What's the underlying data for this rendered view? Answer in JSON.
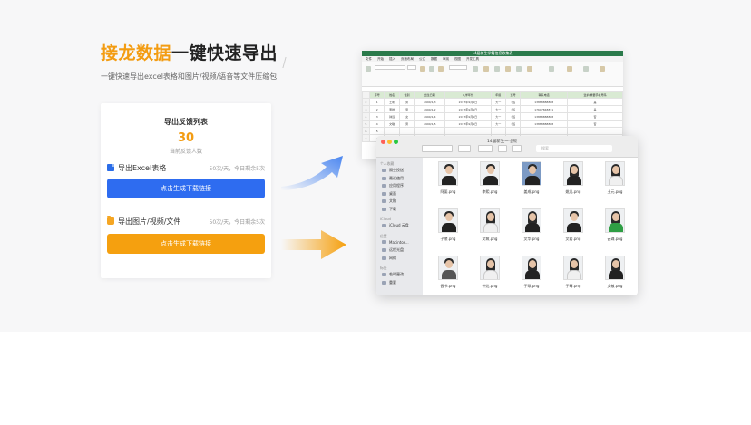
{
  "hero": {
    "title_highlight": "接龙数据",
    "title_rest": "一键快速导出",
    "subtitle": "一键快速导出excel表格和图片/视频/语音等文件压缩包"
  },
  "card": {
    "title": "导出反馈列表",
    "count": "30",
    "count_label": "当前反馈人数",
    "excel": {
      "label": "导出Excel表格",
      "quota": "50次/天，今日剩余5次",
      "button": "点击生成下载链接"
    },
    "media": {
      "label": "导出图片/视频/文件",
      "quota": "50次/天，今日剩余5次",
      "button": "点击生成下载链接"
    }
  },
  "spreadsheet": {
    "window_title": "14届新生学籍信息收集表",
    "menu": [
      "文件",
      "开始",
      "插入",
      "页面布局",
      "公式",
      "数据",
      "审阅",
      "视图",
      "开发工具"
    ],
    "headers": [
      "序号",
      "姓名",
      "性别",
      "出生日期",
      "入学年份",
      "年级",
      "班号",
      "联系电话",
      "监护/重要手机号码"
    ],
    "rows": [
      [
        "1",
        "王昕",
        "男",
        "1990/1/3",
        "2017年9月1日",
        "大一",
        "1班",
        "13888888888",
        "是"
      ],
      [
        "2",
        "李晗",
        "男",
        "1990/1/2",
        "2017年9月1日",
        "大一",
        "1班",
        "17607848871",
        "是"
      ],
      [
        "3",
        "钟远",
        "女",
        "1990/1/4",
        "2017年9月1日",
        "大一",
        "1班",
        "13888888888",
        "否"
      ],
      [
        "4",
        "文敏",
        "男",
        "1990/1/5",
        "2017年9月1日",
        "大一",
        "1班",
        "13888888888",
        "否"
      ],
      [
        "5",
        "",
        "",
        "",
        "",
        "",
        "",
        "",
        ""
      ],
      [
        "6",
        "",
        "",
        "",
        "",
        "",
        "",
        "",
        ""
      ]
    ]
  },
  "finder": {
    "window_title": "14届新生一寸照",
    "search_placeholder": "搜索",
    "sidebar": {
      "favorites_head": "个人收藏",
      "favorites": [
        "隔空投送",
        "最近使用",
        "应用程序",
        "桌面",
        "文稿",
        "下载"
      ],
      "icloud_head": "iCloud",
      "icloud": [
        "iCloud 云盘"
      ],
      "locations_head": "位置",
      "locations": [
        "Macintos...",
        "远程光盘",
        "网络"
      ],
      "tags_head": "标签",
      "tags": [
        "临时更改",
        "重要"
      ]
    },
    "files": [
      {
        "name": "阿斐.png",
        "style": "m1"
      },
      {
        "name": "李熙.png",
        "style": "m2"
      },
      {
        "name": "姜成.png",
        "style": "m3"
      },
      {
        "name": "姚儿.png",
        "style": "f1"
      },
      {
        "name": "土元.png",
        "style": "f2"
      },
      {
        "name": "子陵.png",
        "style": "m4"
      },
      {
        "name": "文筑.png",
        "style": "f3"
      },
      {
        "name": "文华.png",
        "style": "f4"
      },
      {
        "name": "文若.png",
        "style": "m5"
      },
      {
        "name": "云珠.png",
        "style": "f5"
      },
      {
        "name": "云书.png",
        "style": "m6"
      },
      {
        "name": "仲达.png",
        "style": "f6"
      },
      {
        "name": "子琪.png",
        "style": "f7"
      },
      {
        "name": "子骞.png",
        "style": "f8"
      },
      {
        "name": "文敏.png",
        "style": "f9"
      }
    ]
  },
  "colors": {
    "highlight_orange": "#f39c12",
    "button_blue": "#2e6cf0",
    "button_orange": "#f5a00f",
    "excel_green": "#2b7a4b"
  }
}
